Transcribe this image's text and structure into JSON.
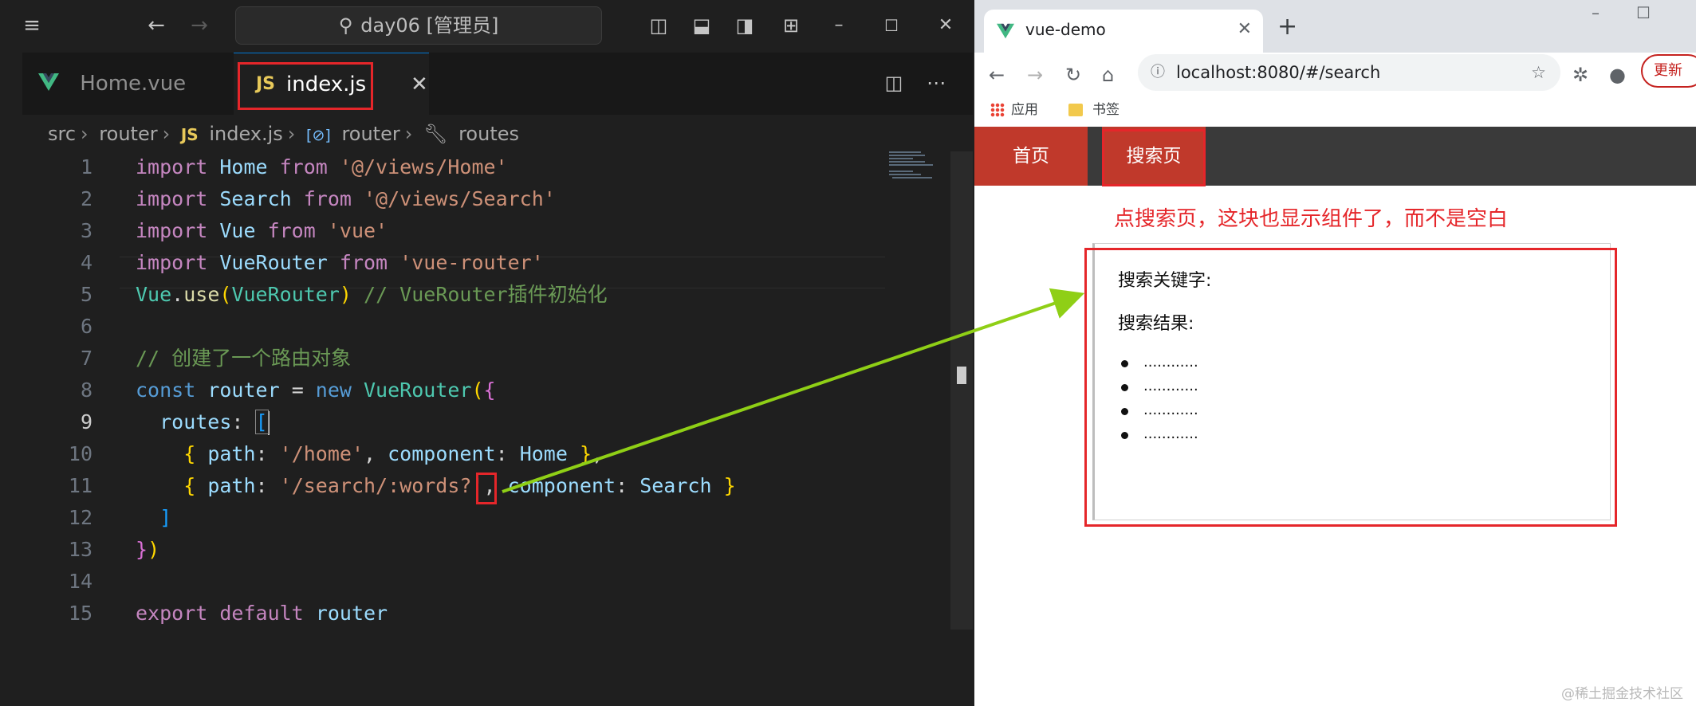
{
  "vscode": {
    "command_center": "day06 [管理员]",
    "tabs": [
      {
        "label": "Home.vue",
        "icon": "vue-icon"
      },
      {
        "label": "index.js",
        "icon": "js-icon"
      }
    ],
    "tab_close": "✕",
    "breadcrumb": {
      "src": "src",
      "router": "router",
      "file_badge": "JS",
      "file": "index.js",
      "symbol_badge": "[⊘]",
      "symbol": "router",
      "routes": "routes"
    },
    "line_numbers": [
      "1",
      "2",
      "3",
      "4",
      "5",
      "6",
      "7",
      "8",
      "9",
      "10",
      "11",
      "12",
      "13",
      "14",
      "15"
    ],
    "code": {
      "l1": [
        "import",
        " Home ",
        "from",
        " '@/views/Home'"
      ],
      "l2": [
        "import",
        " Search ",
        "from",
        " '@/views/Search'"
      ],
      "l3": [
        "import",
        " Vue ",
        "from",
        " 'vue'"
      ],
      "l4": [
        "import",
        " VueRouter ",
        "from",
        " 'vue-router'"
      ],
      "l5": [
        "Vue",
        ".",
        "use",
        "(",
        "VueRouter",
        ")",
        " // VueRouter插件初始化"
      ],
      "l7": "// 创建了一个路由对象",
      "l8": [
        "const",
        " router ",
        "= ",
        "new",
        " VueRouter",
        "(",
        "{"
      ],
      "l9": [
        "  routes",
        ": ",
        "["
      ],
      "l10": [
        "    { ",
        "path",
        ": ",
        "'/home'",
        ", ",
        "component",
        ": ",
        "Home",
        " }",
        ","
      ],
      "l11": [
        "    { ",
        "path",
        ": ",
        "'/search/:words?'",
        ", ",
        "component",
        ": ",
        "Search",
        " }"
      ],
      "l12": "  ]",
      "l13": [
        "}",
        ")"
      ],
      "l15": [
        "export",
        " default",
        " router"
      ]
    }
  },
  "browser": {
    "tab_title": "vue-demo",
    "tab_close": "✕",
    "new_tab": "+",
    "url": "localhost:8080/#/search",
    "update_label": "更新",
    "bookmarks": {
      "apps": "应用",
      "folder": "书签"
    },
    "nav": {
      "home": "首页",
      "search": "搜索页"
    },
    "annotation": "点搜索页，这块也显示组件了，而不是空白",
    "keyword_label": "搜索关键字:",
    "results_label": "搜索结果:",
    "results": [
      "............",
      "............",
      "............",
      "............"
    ],
    "watermark": "@稀土掘金技术社区"
  },
  "colors": {
    "annotation_red": "#e5262a",
    "arrow_green": "#8fcf16",
    "nav_active": "#c0392b",
    "editor_bg": "#1f1f1f"
  }
}
